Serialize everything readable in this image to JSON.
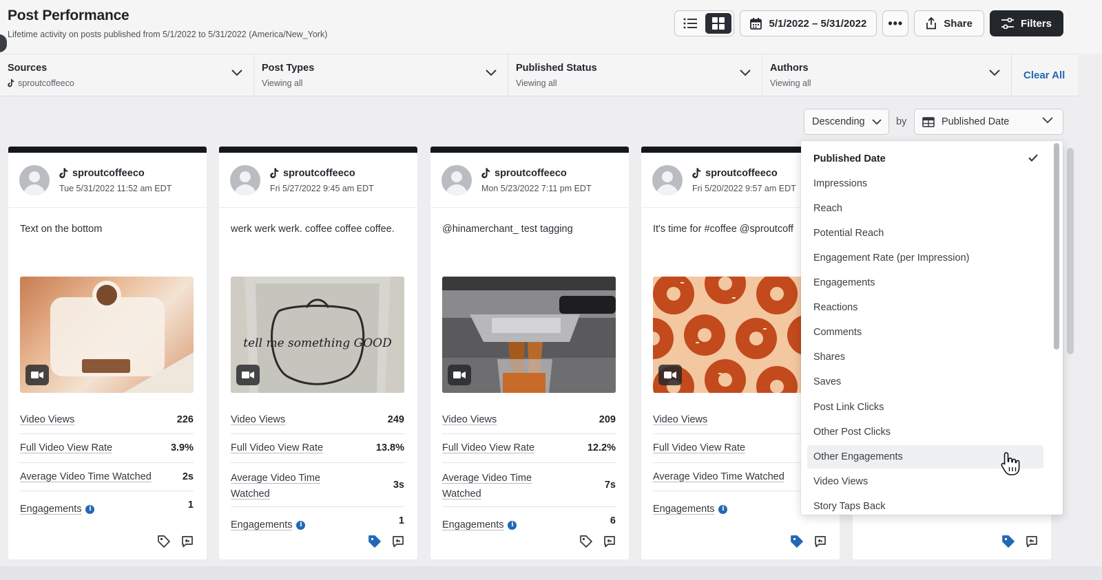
{
  "header": {
    "title": "Post Performance",
    "subtitle": "Lifetime activity on posts published from 5/1/2022 to 5/31/2022 (America/New_York)"
  },
  "toolbar": {
    "date_range": "5/1/2022 – 5/31/2022",
    "more_label": "•••",
    "share_label": "Share",
    "filters_label": "Filters"
  },
  "filters": [
    {
      "label": "Sources",
      "value": "sproutcoffeeco"
    },
    {
      "label": "Post Types",
      "value": "Viewing all"
    },
    {
      "label": "Published Status",
      "value": "Viewing all"
    },
    {
      "label": "Authors",
      "value": "Viewing all"
    }
  ],
  "clear_all": "Clear All",
  "sort": {
    "direction": "Descending",
    "by_label": "by",
    "field": "Published Date"
  },
  "cards": [
    {
      "account": "sproutcoffeeco",
      "date": "Tue 5/31/2022 11:52 am EDT",
      "text": "Text on the bottom",
      "metrics": [
        {
          "label": "Video Views",
          "value": "226"
        },
        {
          "label": "Full Video View Rate",
          "value": "3.9%"
        },
        {
          "label": "Average Video Time Watched",
          "value": "2s"
        },
        {
          "label": "Engagements",
          "value": "1"
        }
      ],
      "tagged": false
    },
    {
      "account": "sproutcoffeeco",
      "date": "Fri 5/27/2022 9:45 am EDT",
      "text": "werk werk werk. coffee coffee coffee.",
      "image_text": "tell me something GOOD",
      "metrics": [
        {
          "label": "Video Views",
          "value": "249"
        },
        {
          "label": "Full Video View Rate",
          "value": "13.8%"
        },
        {
          "label": "Average Video Time Watched",
          "value": "3s"
        },
        {
          "label": "Engagements",
          "value": "1"
        }
      ],
      "tagged": true
    },
    {
      "account": "sproutcoffeeco",
      "date": "Mon 5/23/2022 7:11 pm EDT",
      "text": "@hinamerchant_ test tagging",
      "metrics": [
        {
          "label": "Video Views",
          "value": "209"
        },
        {
          "label": "Full Video View Rate",
          "value": "12.2%"
        },
        {
          "label": "Average Video Time Watched",
          "value": "7s"
        },
        {
          "label": "Engagements",
          "value": "6"
        }
      ],
      "tagged": false
    },
    {
      "account": "sproutcoffeeco",
      "date": "Fri 5/20/2022 9:57 am EDT",
      "text": "It's time for #coffee @sproutcoff",
      "metrics": [
        {
          "label": "Video Views",
          "value": ""
        },
        {
          "label": "Full Video View Rate",
          "value": ""
        },
        {
          "label": "Average Video Time Watched",
          "value": ""
        },
        {
          "label": "Engagements",
          "value": ""
        }
      ],
      "tagged": true
    }
  ],
  "sort_menu": {
    "items": [
      "Published Date",
      "Impressions",
      "Reach",
      "Potential Reach",
      "Engagement Rate (per Impression)",
      "Engagements",
      "Reactions",
      "Comments",
      "Shares",
      "Saves",
      "Post Link Clicks",
      "Other Post Clicks",
      "Other Engagements",
      "Video Views",
      "Story Taps Back"
    ],
    "selected": "Published Date",
    "hovered": "Other Engagements"
  },
  "colors": {
    "accent": "#2268b5",
    "dark": "#23272d",
    "card_top": "#15181b"
  }
}
